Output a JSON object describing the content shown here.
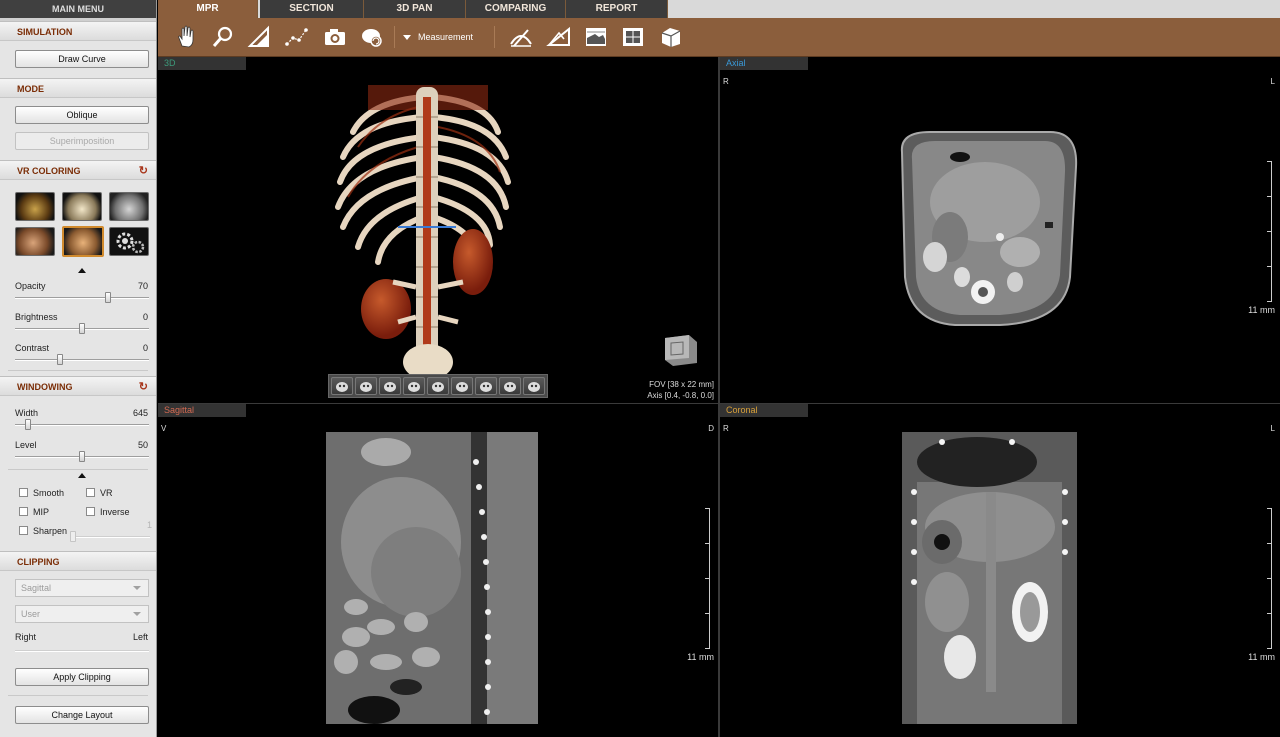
{
  "main_menu": "MAIN MENU",
  "sidebar": {
    "simulation": {
      "title": "SIMULATION",
      "draw_curve": "Draw Curve"
    },
    "mode": {
      "title": "MODE",
      "oblique": "Oblique",
      "superimposition": "Superimposition"
    },
    "vr_coloring": {
      "title": "VR COLORING",
      "presets": [
        "bone-skull-preset",
        "skull-gold-preset",
        "skull-grey-preset",
        "anatomy-preset",
        "organs-preset",
        "settings-gears-preset"
      ],
      "sliders": [
        {
          "label": "Opacity",
          "value": "70",
          "fraction": 0.7
        },
        {
          "label": "Brightness",
          "value": "0",
          "fraction": 0.5
        },
        {
          "label": "Contrast",
          "value": "0",
          "fraction": 0.33
        }
      ]
    },
    "windowing": {
      "title": "WINDOWING",
      "width_label": "Width",
      "width_value": "645",
      "width_fraction": 0.08,
      "level_label": "Level",
      "level_value": "50",
      "level_fraction": 0.5,
      "checks": {
        "smooth": "Smooth",
        "vr": "VR",
        "mip": "MIP",
        "inverse": "Inverse",
        "sharpen": "Sharpen",
        "sharpen_value": "1"
      }
    },
    "clipping": {
      "title": "CLIPPING",
      "plane": "Sagittal",
      "user": "User",
      "right": "Right",
      "left": "Left",
      "apply": "Apply Clipping"
    },
    "change_layout": "Change Layout"
  },
  "tabs": [
    "MPR",
    "SECTION",
    "3D PAN",
    "COMPARING",
    "REPORT"
  ],
  "active_tab": "MPR",
  "toolbar": {
    "tools": [
      "pan-hand-icon",
      "zoom-magnifier-icon",
      "angle-ruler-icon",
      "curve-path-icon",
      "camera-icon",
      "rotate-icon"
    ],
    "measurement": "Measurement",
    "right_tools": [
      "cut-tool-icon",
      "angle-measure-icon",
      "histogram-icon",
      "grid-view-icon",
      "volume-box-icon"
    ]
  },
  "viewports": {
    "v3d": {
      "label": "3D",
      "fov": "FOV [38 x 22 mm]",
      "axis": "Axis [0.4, -0.8, 0.0]",
      "orientation_buttons": 9
    },
    "axial": {
      "label": "Axial",
      "left": "R",
      "right": "L",
      "scale": "11 mm"
    },
    "sagittal": {
      "label": "Sagittal",
      "left": "V",
      "right": "D",
      "scale": "11 mm"
    },
    "coronal": {
      "label": "Coronal",
      "left": "R",
      "right": "L",
      "scale": "11 mm"
    }
  },
  "colors": {
    "accent": "#8b5e3c",
    "section_title": "#7a2c05",
    "label_3d": "#3d9a7b",
    "label_axial": "#3a98d6",
    "label_sagittal": "#d36a52",
    "label_coronal": "#d9a13a"
  }
}
